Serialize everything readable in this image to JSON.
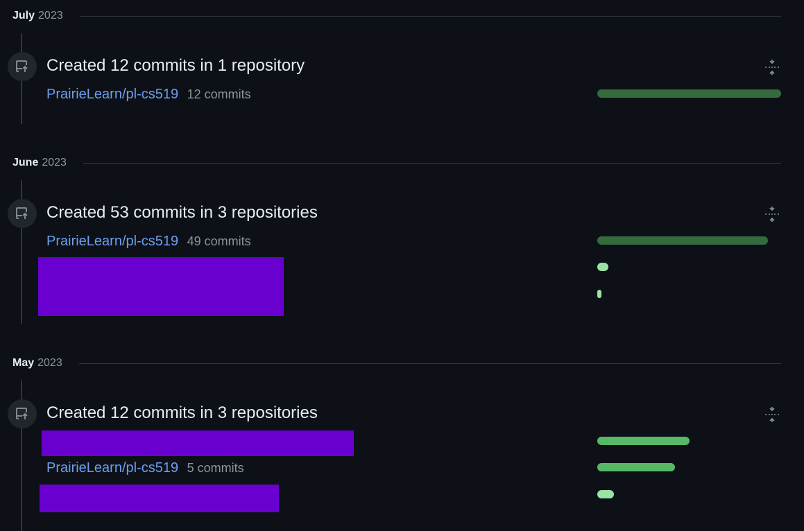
{
  "colors": {
    "background": "#0d1117",
    "link": "#6e9ef0",
    "muted": "#8b949e",
    "bar_dark": "#336b3e",
    "bar_mid": "#57b865",
    "bar_light": "#9be3a4",
    "redaction": "#6a00d0"
  },
  "months": [
    {
      "month": "July",
      "year": "2023",
      "event": {
        "icon": "repo-push-icon",
        "title": "Created 12 commits in 1 repository",
        "repos": [
          {
            "name": "PrairieLearn/pl-cs519",
            "count": "12 commits",
            "bar_fraction": 1.0,
            "bar_color": "#336b3e"
          }
        ]
      }
    },
    {
      "month": "June",
      "year": "2023",
      "event": {
        "icon": "repo-push-icon",
        "title": "Created 53 commits in 3 repositories",
        "repos": [
          {
            "name": "PrairieLearn/pl-cs519",
            "count": "49 commits",
            "bar_fraction": 0.93,
            "bar_color": "#336b3e"
          },
          {
            "name": "",
            "count": "",
            "bar_fraction": 0.06,
            "bar_color": "#9be3a4"
          },
          {
            "name": "",
            "count": "",
            "bar_fraction": 0.02,
            "bar_color": "#9be3a4"
          }
        ]
      }
    },
    {
      "month": "May",
      "year": "2023",
      "event": {
        "icon": "repo-push-icon",
        "title": "Created 12 commits in 3 repositories",
        "repos": [
          {
            "name": "",
            "count": "",
            "bar_fraction": 0.5,
            "bar_color": "#57b865"
          },
          {
            "name": "PrairieLearn/pl-cs519",
            "count": "5 commits",
            "bar_fraction": 0.42,
            "bar_color": "#57b865"
          },
          {
            "name": "",
            "count": "",
            "bar_fraction": 0.09,
            "bar_color": "#9be3a4"
          }
        ]
      }
    }
  ]
}
